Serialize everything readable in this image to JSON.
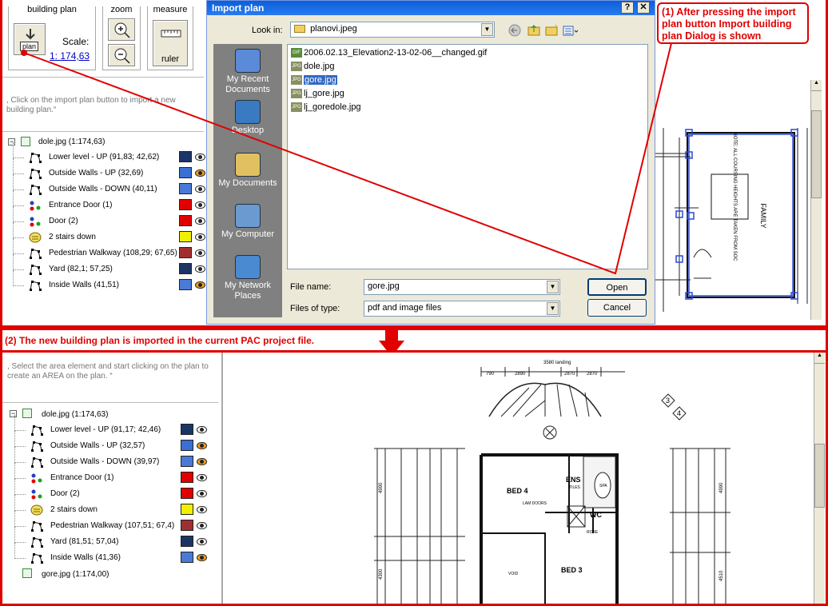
{
  "top_toolbar": {
    "building_plan": {
      "title": "building plan",
      "plan_button": "plan",
      "scale_label": "Scale:",
      "scale_value": "1: 174,63"
    },
    "zoom": {
      "title": "zoom"
    },
    "measure": {
      "title": "measure",
      "ruler_label": "ruler"
    }
  },
  "hint_top": ", Click on the import plan button to import a new building plan.“",
  "tree_top": {
    "root": "dole.jpg (1:174,63)",
    "items": [
      {
        "label": "Lower level - UP (91,83; 42,62)",
        "color": "#1c3567",
        "lock": false
      },
      {
        "label": "Outside Walls - UP (32,69)",
        "color": "#3a6fd4",
        "lock": true
      },
      {
        "label": "Outside Walls - DOWN (40,11)",
        "color": "#4a7ad8",
        "lock": false
      },
      {
        "label": "Entrance Door (1)",
        "color": "#e00000",
        "lock": false
      },
      {
        "label": "Door (2)",
        "color": "#e00000",
        "lock": false
      },
      {
        "label": "2 stairs down",
        "color": "#f0f000",
        "lock": false
      },
      {
        "label": "Pedestrian Walkway (108,29; 67,65)",
        "color": "#a03030",
        "lock": false
      },
      {
        "label": "Yard (82,1; 57,25)",
        "color": "#1c3567",
        "lock": false
      },
      {
        "label": "Inside Walls (41,51)",
        "color": "#4a7ad8",
        "lock": true
      }
    ]
  },
  "dialog": {
    "title": "Import plan",
    "help_btn": "?",
    "close_btn": "✕",
    "look_in_label": "Look in:",
    "look_in_value": "planovi.jpeg",
    "places": [
      "My Recent Documents",
      "Desktop",
      "My Documents",
      "My Computer",
      "My Network Places"
    ],
    "files": [
      {
        "name": "2006.02.13_Elevation2-13-02-06__changed.gif",
        "type": "GIF",
        "selected": false
      },
      {
        "name": "dole.jpg",
        "type": "JPG",
        "selected": false
      },
      {
        "name": "gore.jpg",
        "type": "JPG",
        "selected": true
      },
      {
        "name": "lj_gore.jpg",
        "type": "JPG",
        "selected": false
      },
      {
        "name": "lj_goredole.jpg",
        "type": "JPG",
        "selected": false
      }
    ],
    "file_name_label": "File name:",
    "file_name_value": "gore.jpg",
    "files_of_type_label": "Files of type:",
    "files_of_type_value": "pdf and image files",
    "open_btn": "Open",
    "cancel_btn": "Cancel"
  },
  "callout_1": "(1) After pressing the import plan button Import building plan Dialog is shown",
  "banner_2": "(2) The new building plan is imported in the current PAC project file.",
  "hint_bottom": ", Select the area element and start clicking on the plan to create an AREA on the plan. “",
  "tree_bottom": {
    "root": "dole.jpg (1:174,63)",
    "items": [
      {
        "label": "Lower level - UP (91,17; 42,46)",
        "color": "#1c3567",
        "lock": false
      },
      {
        "label": "Outside Walls - UP (32,57)",
        "color": "#3a6fd4",
        "lock": true
      },
      {
        "label": "Outside Walls - DOWN (39,97)",
        "color": "#4a7ad8",
        "lock": true
      },
      {
        "label": "Entrance Door (1)",
        "color": "#e00000",
        "lock": false
      },
      {
        "label": "Door (2)",
        "color": "#e00000",
        "lock": false
      },
      {
        "label": "2 stairs down",
        "color": "#f0f000",
        "lock": false
      },
      {
        "label": "Pedestrian Walkway (107,51; 67,4)",
        "color": "#a03030",
        "lock": false
      },
      {
        "label": "Yard (81,51; 57,04)",
        "color": "#1c3567",
        "lock": false
      },
      {
        "label": "Inside Walls (41,36)",
        "color": "#4a7ad8",
        "lock": true
      }
    ],
    "second_root": "gore.jpg (1:174,00)"
  },
  "plan_top": {
    "family": "FAMILY",
    "note": "NOTE: ALL COURSING HEIGHTS ARE TAKEN FROM SOC"
  },
  "plan_bottom": {
    "bed4": "BED 4",
    "ens": "ENS",
    "tiles": "TILES",
    "bed3": "BED 3",
    "wc": "WC",
    "robe": "ROBE",
    "void": "VOID",
    "spa": "SPA",
    "lam_doors": "LAM DOORS",
    "dims_top": [
      "790",
      "2890",
      "2870",
      "2870",
      "3580 landing"
    ],
    "dims_left": [
      "4990",
      "4300"
    ],
    "dims_right": [
      "4990",
      "4510"
    ],
    "markers": [
      "3",
      "4"
    ]
  }
}
